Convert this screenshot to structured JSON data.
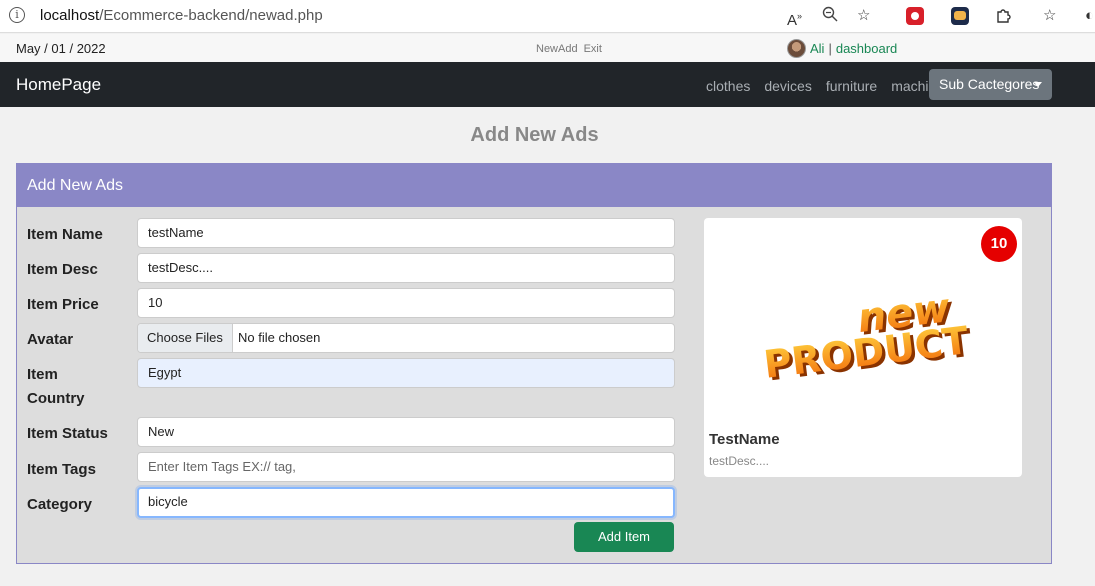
{
  "browser": {
    "url_host": "localhost",
    "url_path": "/Ecommerce-backend/newad.php"
  },
  "top_info": {
    "date": "May / 01 / 2022",
    "new_add": "NewAdd",
    "exit": "Exit",
    "user_name": "Ali",
    "separator": "|",
    "dashboard": "dashboard"
  },
  "navbar": {
    "brand": "HomePage",
    "links": [
      "clothes",
      "devices",
      "furniture",
      "machine"
    ],
    "dropdown": "Sub Cactegores"
  },
  "page": {
    "title": "Add New Ads"
  },
  "panel": {
    "heading": "Add New Ads",
    "fields": {
      "name": {
        "label": "Item Name",
        "value": "testName"
      },
      "desc": {
        "label": "Item Desc",
        "value": "testDesc...."
      },
      "price": {
        "label": "Item Price",
        "value": "10"
      },
      "avatar": {
        "label": "Avatar",
        "button": "Choose Files",
        "status": "No file chosen"
      },
      "country": {
        "label_line1": "Item",
        "label_line2": "Country",
        "value": "Egypt"
      },
      "status": {
        "label": "Item Status",
        "value": "New"
      },
      "tags": {
        "label": "Item Tags",
        "placeholder": "Enter Item Tags EX:// tag,"
      },
      "category": {
        "label": "Category",
        "value": "bicycle"
      }
    },
    "submit": "Add Item"
  },
  "preview": {
    "badge": "10",
    "image_text_top": "new",
    "image_text_bottom": "PRODUCT",
    "title": "TestName",
    "desc": "testDesc...."
  },
  "colors": {
    "navbar": "#212529",
    "panel_header": "#8a87c6",
    "submit": "#198754",
    "badge": "#e50000",
    "link_green": "#198754"
  }
}
